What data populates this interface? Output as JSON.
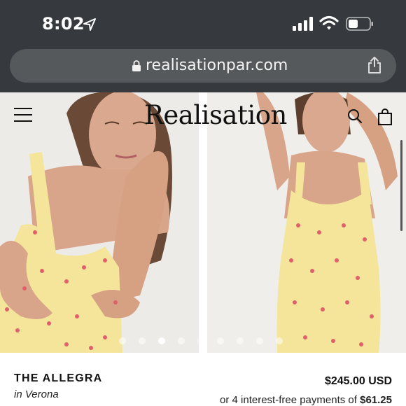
{
  "status_bar": {
    "time": "8:02"
  },
  "browser": {
    "url": "realisationpar.com"
  },
  "site": {
    "brand": "Realisation"
  },
  "gallery": {
    "image_count": 2,
    "dot_count": 9,
    "active_dot_index": 2
  },
  "product": {
    "name": "THE ALLEGRA",
    "color_prefix": "in",
    "color": "Verona",
    "price": "$245.00 USD",
    "installments_prefix": "or 4 interest-free payments of",
    "installments_amount": "$61.25"
  },
  "colors": {
    "chrome": "#363a3e",
    "urlbar": "#56595c",
    "dress": "#f4e59a",
    "print": "#e0606a"
  }
}
